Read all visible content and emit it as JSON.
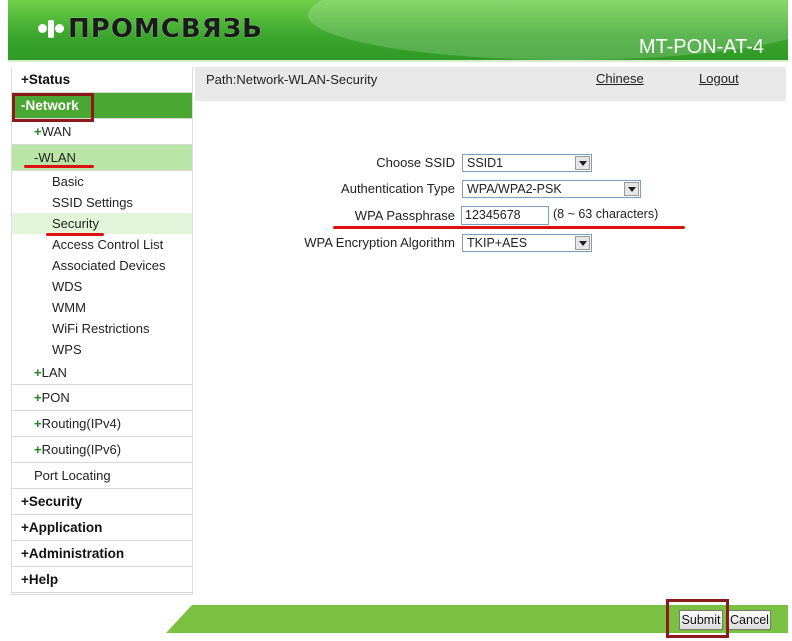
{
  "header": {
    "logo_text": "ПРОМСВЯЗЬ",
    "model": "MT-PON-AT-4"
  },
  "sidebar": {
    "status": "Status",
    "network": "Network",
    "wan": "WAN",
    "wlan": "WLAN",
    "wlan_items": [
      "Basic",
      "SSID Settings",
      "Security",
      "Access Control List",
      "Associated Devices",
      "WDS",
      "WMM",
      "WiFi Restrictions",
      "WPS"
    ],
    "lan": "LAN",
    "pon": "PON",
    "routing_ipv4": "Routing(IPv4)",
    "routing_ipv6": "Routing(IPv6)",
    "port_locating": "Port Locating",
    "security": "Security",
    "application": "Application",
    "administration": "Administration",
    "help": "Help",
    "plus": "+",
    "minus": "-"
  },
  "pathbar": {
    "path": "Path:Network-WLAN-Security",
    "chinese": "Chinese",
    "logout": "Logout"
  },
  "form": {
    "choose_ssid_label": "Choose SSID",
    "choose_ssid_value": "SSID1",
    "auth_type_label": "Authentication Type",
    "auth_type_value": "WPA/WPA2-PSK",
    "passphrase_label": "WPA Passphrase",
    "passphrase_value": "12345678",
    "passphrase_hint": "(8 ~ 63 characters)",
    "encryption_label": "WPA Encryption Algorithm",
    "encryption_value": "TKIP+AES"
  },
  "footer": {
    "submit": "Submit",
    "cancel": "Cancel"
  },
  "colors": {
    "brand_green": "#4aa732",
    "annotation_red": "#d11111",
    "annotation_box": "#8b1a1a"
  }
}
